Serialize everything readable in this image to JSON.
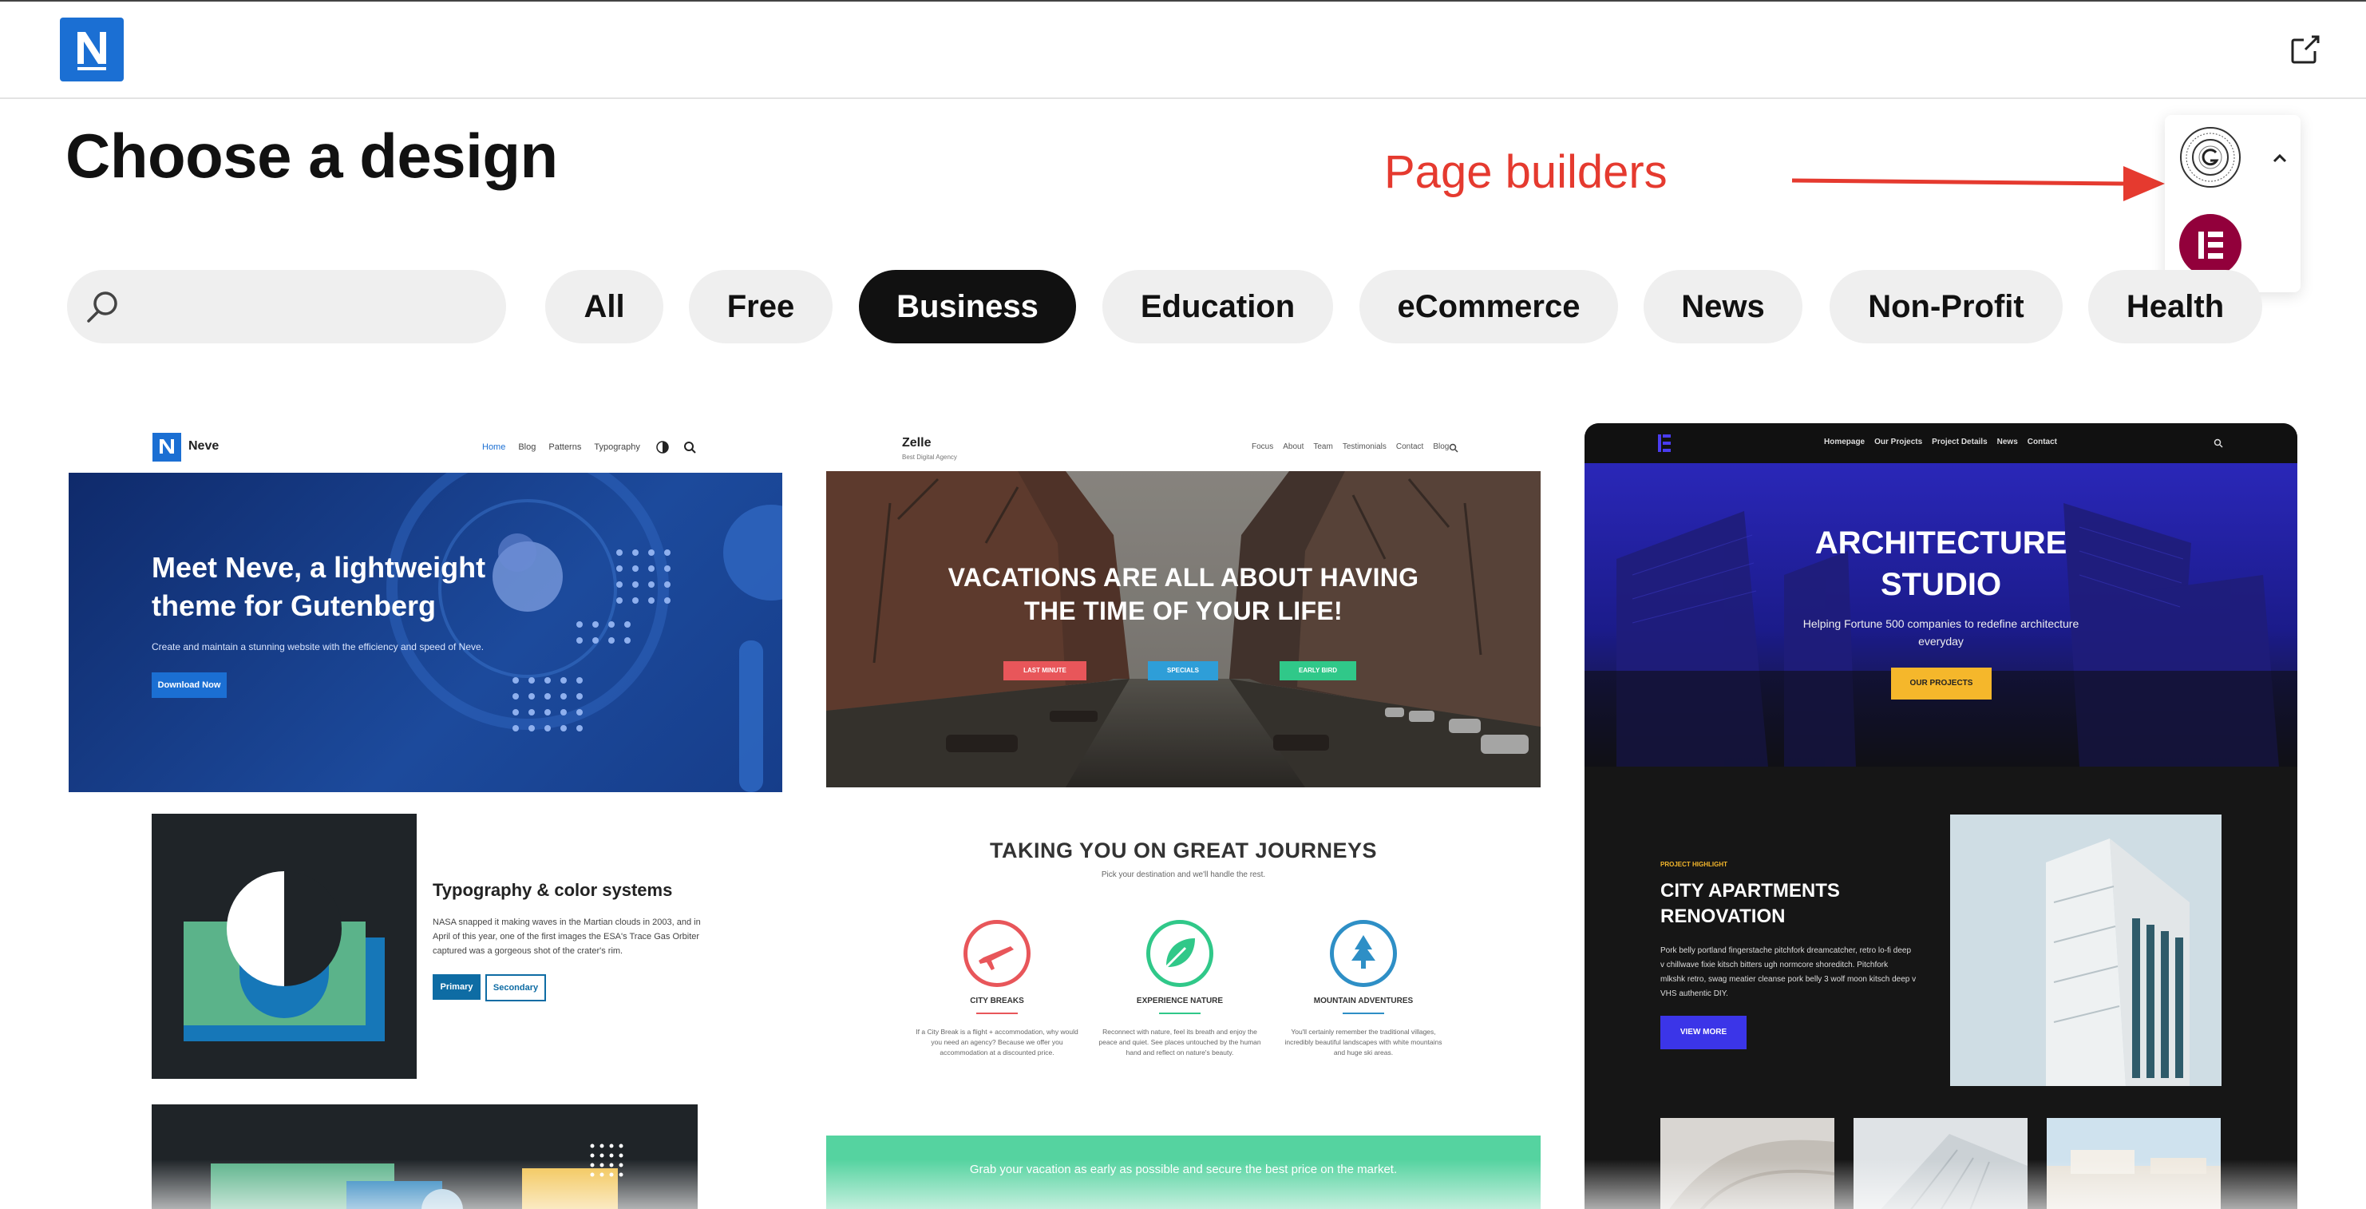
{
  "header": {
    "logo_letter": "N"
  },
  "page": {
    "title": "Choose a design"
  },
  "annotation": {
    "label": "Page builders"
  },
  "search": {
    "placeholder": ""
  },
  "filters": [
    "All",
    "Free",
    "Business",
    "Education",
    "eCommerce",
    "News",
    "Non-Profit",
    "Health"
  ],
  "active_filter": "Business",
  "cards": {
    "neve": {
      "brand": "Neve",
      "nav": [
        "Home",
        "Blog",
        "Patterns",
        "Typography"
      ],
      "hero_title_1": "Meet Neve, a lightweight",
      "hero_title_2": "theme for Gutenberg",
      "hero_sub": "Create and maintain a stunning website with the efficiency and speed of Neve.",
      "hero_btn": "Download Now",
      "feature_title": "Typography & color systems",
      "feature_p1": "NASA snapped it making waves in the Martian clouds in 2003, and in",
      "feature_p2": "April of this year, one of the first images the ESA's Trace Gas Orbiter",
      "feature_p3": "captured was a gorgeous shot of the crater's rim.",
      "btn_primary": "Primary",
      "btn_secondary": "Secondary"
    },
    "zelle": {
      "brand": "Zelle",
      "tagline": "Best Digital Agency",
      "nav": [
        "Focus",
        "About",
        "Team",
        "Testimonials",
        "Contact",
        "Blog"
      ],
      "hero_1": "VACATIONS ARE ALL ABOUT HAVING",
      "hero_2": "THE TIME OF YOUR LIFE!",
      "btn_1": "LAST MINUTE",
      "btn_2": "SPECIALS",
      "btn_3": "EARLY BIRD",
      "section_title": "TAKING YOU ON GREAT JOURNEYS",
      "section_sub": "Pick your destination and we'll handle the rest.",
      "features": [
        {
          "title": "CITY BREAKS",
          "l1": "If a City Break is a flight + accommodation, why would",
          "l2": "you need an agency? Because we offer you",
          "l3": "accommodation at a discounted price."
        },
        {
          "title": "EXPERIENCE NATURE",
          "l1": "Reconnect with nature, feel its breath and enjoy the",
          "l2": "peace and quiet. See places untouched by the human",
          "l3": "hand and reflect on nature's beauty."
        },
        {
          "title": "MOUNTAIN ADVENTURES",
          "l1": "You'll certainly remember the traditional villages,",
          "l2": "incredibly beautiful landscapes with white mountains",
          "l3": "and huge ski areas."
        }
      ],
      "banner": "Grab your vacation as early as possible and secure the best price on the market."
    },
    "architecture": {
      "nav": [
        "Homepage",
        "Our Projects",
        "Project Details",
        "News",
        "Contact"
      ],
      "hero_1": "ARCHITECTURE",
      "hero_2": "STUDIO",
      "hero_sub_1": "Helping Fortune 500 companies to redefine architecture",
      "hero_sub_2": "everyday",
      "hero_btn": "OUR PROJECTS",
      "kicker": "PROJECT HIGHLIGHT",
      "project_title_1": "CITY APARTMENTS",
      "project_title_2": "RENOVATION",
      "project_p1": "Pork belly portland fingerstache pitchfork dreamcatcher, retro lo-fi deep",
      "project_p2": "v chillwave fixie kitsch bitters ugh normcore shoreditch. Pitchfork",
      "project_p3": "mlkshk retro, swag meatier cleanse pork belly 3 wolf moon kitsch deep v",
      "project_p4": "VHS authentic DIY.",
      "project_btn": "VIEW MORE"
    }
  },
  "colors": {
    "accent_blue": "#1b6fd3",
    "annotation_red": "#e53a2f",
    "active_chip": "#111111",
    "chip_bg": "#efefef",
    "elementor": "#92003b"
  }
}
